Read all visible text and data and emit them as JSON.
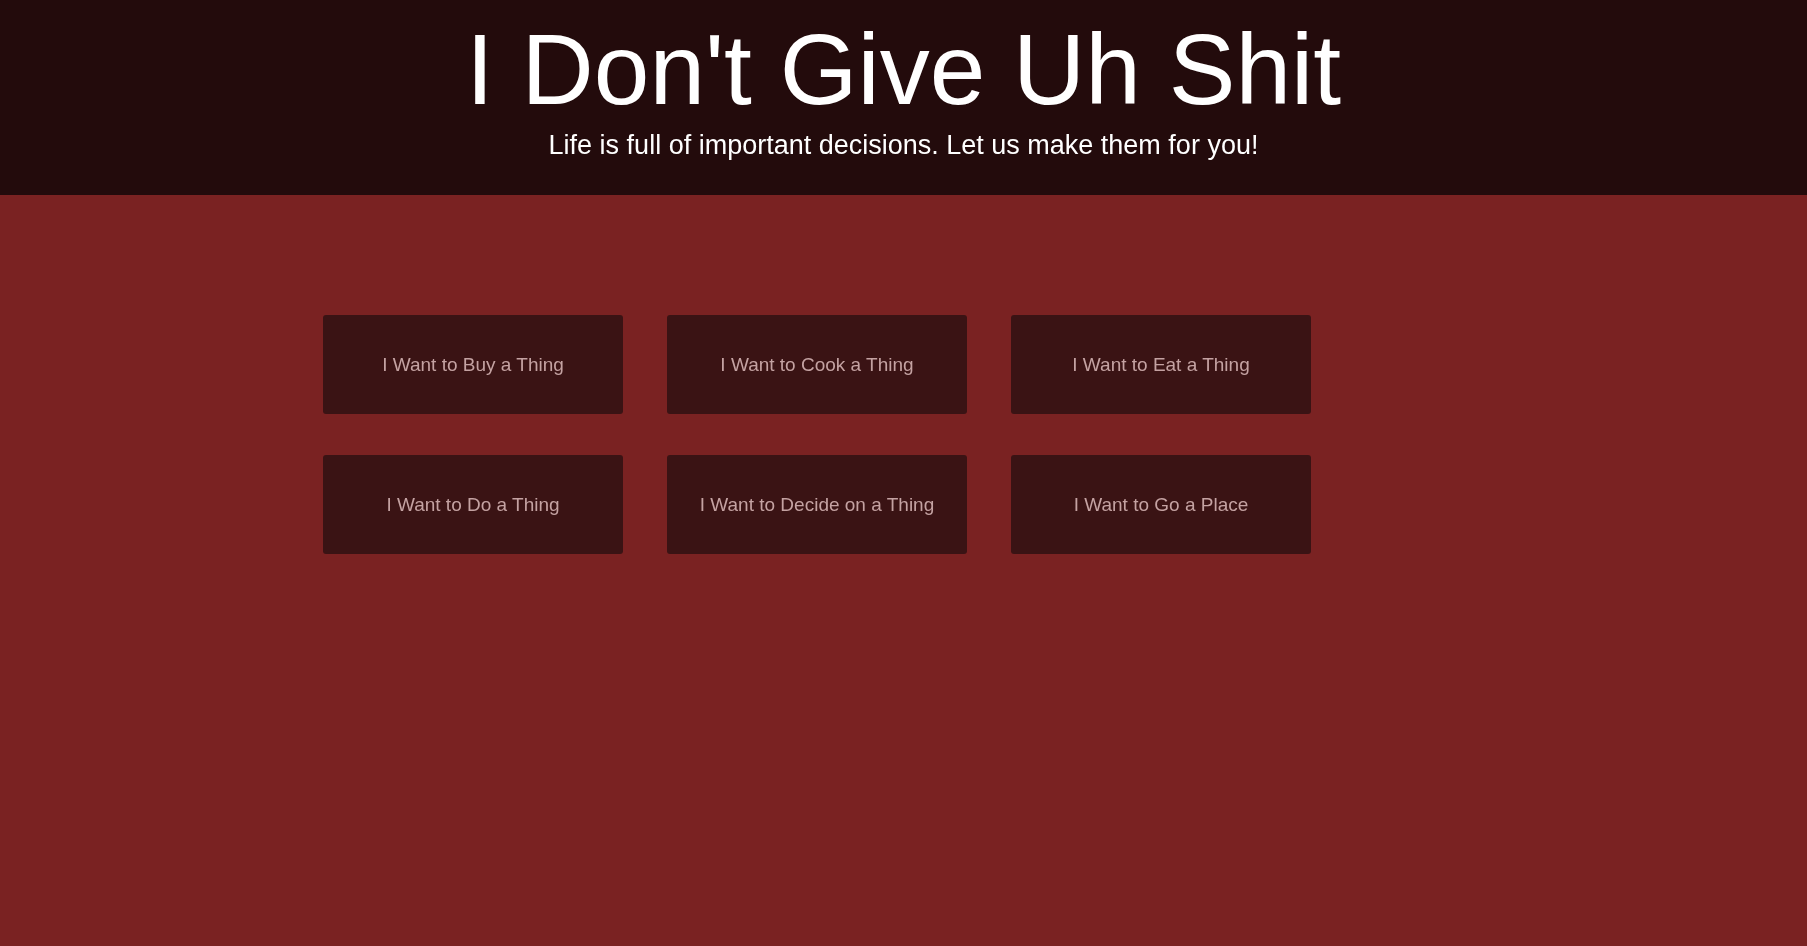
{
  "header": {
    "title": "I Don't Give Uh Shit",
    "tagline": "Life is full of important decisions. Let us make them for you!"
  },
  "choices": [
    {
      "label": "I Want to Buy a Thing"
    },
    {
      "label": "I Want to Cook a Thing"
    },
    {
      "label": "I Want to Eat a Thing"
    },
    {
      "label": "I Want to Do a Thing"
    },
    {
      "label": "I Want to Decide on a Thing"
    },
    {
      "label": "I Want to Go a Place"
    }
  ]
}
